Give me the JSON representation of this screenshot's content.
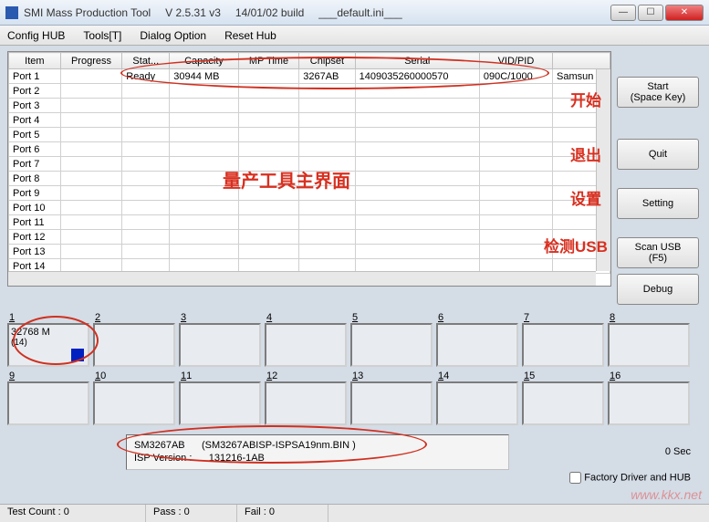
{
  "title": {
    "app": "SMI Mass Production Tool",
    "version": "V 2.5.31  v3",
    "build": "14/01/02 build",
    "ini": "___default.ini___"
  },
  "menu": [
    "Config HUB",
    "Tools[T]",
    "Dialog Option",
    "Reset Hub"
  ],
  "columns": [
    "Item",
    "Progress",
    "Stat...",
    "Capacity",
    "MP Time",
    "Chipset",
    "Serial",
    "VID/PID",
    ""
  ],
  "rows": [
    {
      "item": "Port 1",
      "progress": "",
      "status": "Ready",
      "capacity": "30944 MB",
      "mptime": "",
      "chipset": "3267AB",
      "serial": "1409035260000570",
      "vidpid": "090C/1000",
      "extra": "Samsun"
    },
    {
      "item": "Port 2"
    },
    {
      "item": "Port 3"
    },
    {
      "item": "Port 4"
    },
    {
      "item": "Port 5"
    },
    {
      "item": "Port 6"
    },
    {
      "item": "Port 7"
    },
    {
      "item": "Port 8"
    },
    {
      "item": "Port 9"
    },
    {
      "item": "Port 10"
    },
    {
      "item": "Port 11"
    },
    {
      "item": "Port 12"
    },
    {
      "item": "Port 13"
    },
    {
      "item": "Port 14"
    }
  ],
  "buttons": {
    "start_l1": "Start",
    "start_l2": "(Space Key)",
    "quit": "Quit",
    "setting": "Setting",
    "scan_l1": "Scan USB",
    "scan_l2": "(F5)",
    "debug": "Debug"
  },
  "annot": {
    "main": "量产工具主界面",
    "start": "开始",
    "quit": "退出",
    "setting": "设置",
    "scan": "检测USB"
  },
  "slots": [
    {
      "n": "1",
      "cap": "32768 M",
      "sub": "(14)",
      "filled": true
    },
    {
      "n": "2"
    },
    {
      "n": "3"
    },
    {
      "n": "4"
    },
    {
      "n": "5"
    },
    {
      "n": "6"
    },
    {
      "n": "7"
    },
    {
      "n": "8"
    },
    {
      "n": "9"
    },
    {
      "n": "10"
    },
    {
      "n": "11"
    },
    {
      "n": "12"
    },
    {
      "n": "13"
    },
    {
      "n": "14"
    },
    {
      "n": "15"
    },
    {
      "n": "16"
    }
  ],
  "info": {
    "chip": "SM3267AB",
    "bin": "(SM3267ABISP-ISPSA19nm.BIN )",
    "isp_label": "ISP Version :",
    "isp_ver": "131216-1AB"
  },
  "sec": "0 Sec",
  "factory": "Factory Driver and HUB",
  "status": {
    "test": "Test Count : 0",
    "pass": "Pass : 0",
    "fail": "Fail : 0"
  },
  "watermark": "www.kkx.net"
}
